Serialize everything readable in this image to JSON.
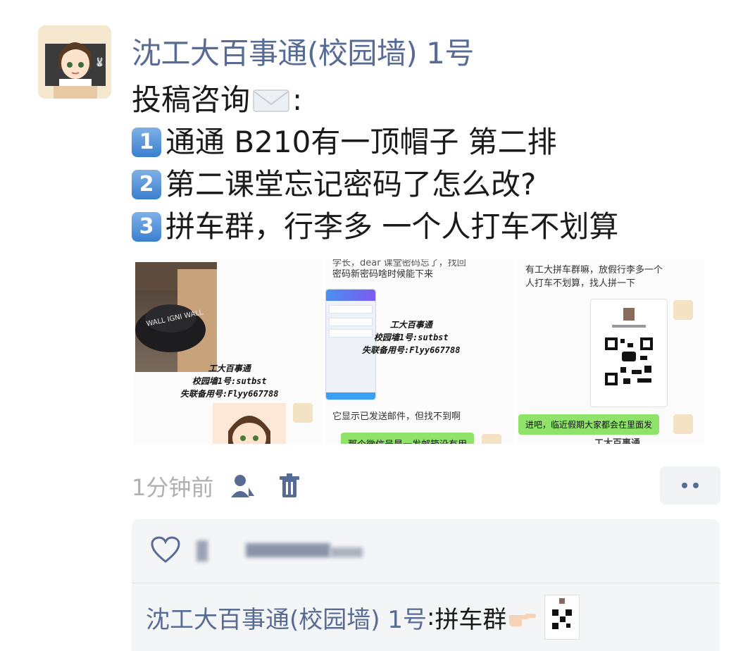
{
  "post": {
    "author": "沈工大百事通(校园墙) 1号",
    "lines": [
      {
        "text": "投稿咨询"
      },
      {
        "badge": "1",
        "text": "通通 B210有一顶帽子 第二排"
      },
      {
        "badge": "2",
        "text": "第二课堂忘记密码了怎么改?"
      },
      {
        "badge": "3",
        "text": "拼车群，行李多 一个人打车不划算"
      }
    ],
    "title_suffix": ":"
  },
  "media": {
    "shot1": {
      "wm_line1": "工大百事通",
      "wm_line2": "校园墙1号:sutbst",
      "wm_line3": "失联备用号:Flyy667788"
    },
    "shot2": {
      "top_text_1": "学长，dear 课堂密码忘了，找回",
      "top_text_2": "密码新密码啥时候能下来",
      "wm_line1": "工大百事通",
      "wm_line2": "校园墙1号:sutbst",
      "wm_line3": "失联备用号:Flyy667788",
      "bottom_text": "它显示已发送邮件，但找不到啊",
      "green_text": "那个微信号是一发邮箱没有用"
    },
    "shot3": {
      "top_text_1": "有工大拼车群嘛，放假行李多一个",
      "top_text_2": "人打车不划算，找人拼一下",
      "green_text": "进吧，临近假期大家都会在里面发",
      "bottom_text": "工大百事通"
    }
  },
  "meta": {
    "time": "1分钟前",
    "icons": [
      "person-icon",
      "trash-icon",
      "more-icon",
      "heart-icon"
    ]
  },
  "comment": {
    "author": "沈工大百事通(校园墙) 1号",
    "separator": ": ",
    "text": "拼车群"
  },
  "colors": {
    "link_blue": "#576b95",
    "bubble_green": "#8fe36a",
    "time_gray": "#b0b0b0"
  }
}
